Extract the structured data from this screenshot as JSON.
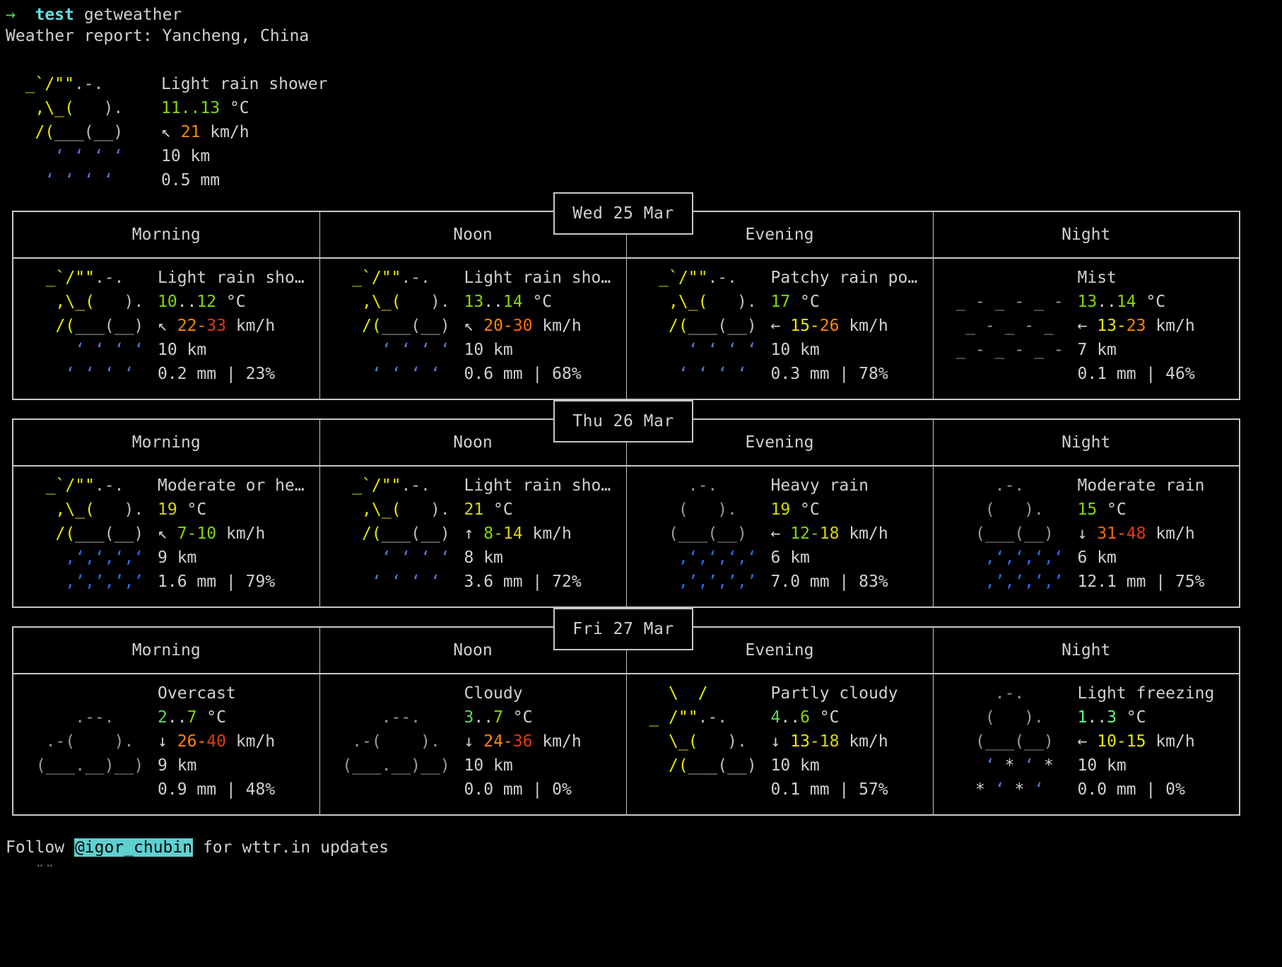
{
  "terminal": {
    "prompt_symbol": "→",
    "command_name": "test",
    "command_arg": "getweather",
    "report_header": "Weather report: Yancheng, China",
    "footer_prefix": "Follow ",
    "footer_handle": "@igor_chubin",
    "footer_suffix": " for wttr.in updates",
    "footer_cutoff": "   \"\"."
  },
  "current": {
    "art": [
      "  _`/\"\".-.  ",
      "   ,\\_(   ). ",
      "   /(___(__) ",
      "     ‘ ‘ ‘ ‘ ",
      "    ‘ ‘ ‘ ‘  "
    ],
    "condition": "Light rain shower",
    "temp": "11..13",
    "temp_unit": " °C",
    "wind_arrow": "↖",
    "wind": "21",
    "wind_unit": " km/h",
    "visibility": "10 km",
    "precip": "0.5 mm"
  },
  "period_labels": [
    "Morning",
    "Noon",
    "Evening",
    "Night"
  ],
  "days": [
    {
      "date": "Wed 25 Mar",
      "cells": [
        {
          "period": "Morning",
          "art_style": "rain-shower",
          "art": [
            "  _`/\"\".-.",
            "   ,\\_(   ).",
            "   /(___(__)",
            "     ‘ ‘ ‘ ‘",
            "    ‘ ‘ ‘ ‘"
          ],
          "condition": "Light rain sho…",
          "temp_lo": "10",
          "temp_sep": "..",
          "temp_hi": "12",
          "temp_unit": " °C",
          "temp_lo_color": "lime",
          "temp_hi_color": "lime",
          "wind_arrow": "↖",
          "wind_lo": "22",
          "wind_hi": "33",
          "wind_lo_color": "orange",
          "wind_hi_color": "red",
          "wind_unit": " km/h",
          "visibility": "10 km",
          "precip": "0.2 mm | 23%"
        },
        {
          "period": "Noon",
          "art_style": "rain-shower",
          "art": [
            "  _`/\"\".-.",
            "   ,\\_(   ).",
            "   /(___(__)",
            "     ‘ ‘ ‘ ‘",
            "    ‘ ‘ ‘ ‘"
          ],
          "condition": "Light rain sho…",
          "temp_lo": "13",
          "temp_sep": "..",
          "temp_hi": "14",
          "temp_unit": " °C",
          "temp_lo_color": "lime",
          "temp_hi_color": "lime",
          "wind_arrow": "↖",
          "wind_lo": "20",
          "wind_hi": "30",
          "wind_lo_color": "orange",
          "wind_hi_color": "darkorange",
          "wind_unit": " km/h",
          "visibility": "10 km",
          "precip": "0.6 mm | 68%"
        },
        {
          "period": "Evening",
          "art_style": "rain-shower",
          "art": [
            "  _`/\"\".-.",
            "   ,\\_(   ).",
            "   /(___(__)",
            "     ‘ ‘ ‘ ‘",
            "    ‘ ‘ ‘ ‘"
          ],
          "condition": "Patchy rain po…",
          "temp_lo": "17",
          "temp_sep": "",
          "temp_hi": "",
          "temp_unit": " °C",
          "temp_lo_color": "lime",
          "temp_hi_color": "lime",
          "wind_arrow": "←",
          "wind_lo": "15",
          "wind_hi": "26",
          "wind_lo_color": "yellow",
          "wind_hi_color": "orange",
          "wind_unit": " km/h",
          "visibility": "10 km",
          "precip": "0.3 mm | 78%"
        },
        {
          "period": "Night",
          "art_style": "mist",
          "art": [
            " _ - _ - _ -",
            "  _ - _ - _",
            " _ - _ - _ -"
          ],
          "condition": "Mist",
          "temp_lo": "13",
          "temp_sep": "..",
          "temp_hi": "14",
          "temp_unit": " °C",
          "temp_lo_color": "lime",
          "temp_hi_color": "lime",
          "wind_arrow": "←",
          "wind_lo": "13",
          "wind_hi": "23",
          "wind_lo_color": "yellow",
          "wind_hi_color": "orange",
          "wind_unit": " km/h",
          "visibility": "7 km",
          "precip": "0.1 mm | 46%"
        }
      ]
    },
    {
      "date": "Thu 26 Mar",
      "cells": [
        {
          "period": "Morning",
          "art_style": "heavy-rain-sun",
          "art": [
            "  _`/\"\".-.",
            "   ,\\_(   ).",
            "   /(___(__)",
            "    ‚‘‚‘‚‘‚‘",
            "    ‚’‚’‚’‚’"
          ],
          "condition": "Moderate or he…",
          "temp_lo": "19",
          "temp_sep": "",
          "temp_hi": "",
          "temp_unit": " °C",
          "temp_lo_color": "gold",
          "temp_hi_color": "gold",
          "wind_arrow": "↖",
          "wind_lo": "7",
          "wind_hi": "10",
          "wind_lo_color": "lime",
          "wind_hi_color": "lime",
          "wind_unit": " km/h",
          "visibility": "9 km",
          "precip": "1.6 mm | 79%"
        },
        {
          "period": "Noon",
          "art_style": "rain-shower",
          "art": [
            "  _`/\"\".-.",
            "   ,\\_(   ).",
            "   /(___(__)",
            "     ‘ ‘ ‘ ‘",
            "    ‘ ‘ ‘ ‘"
          ],
          "condition": "Light rain sho…",
          "temp_lo": "21",
          "temp_sep": "",
          "temp_hi": "",
          "temp_unit": " °C",
          "temp_lo_color": "gold",
          "temp_hi_color": "gold",
          "wind_arrow": "↑",
          "wind_lo": "8",
          "wind_hi": "14",
          "wind_lo_color": "lime",
          "wind_hi_color": "gold",
          "wind_unit": " km/h",
          "visibility": "8 km",
          "precip": "3.6 mm | 72%"
        },
        {
          "period": "Evening",
          "art_style": "heavy-rain",
          "art": [
            "     .-.",
            "    (   ).",
            "   (___(__)",
            "    ‚‘‚‘‚‘‚‘",
            "    ‚’‚’‚’‚’"
          ],
          "condition": "Heavy rain",
          "temp_lo": "19",
          "temp_sep": "",
          "temp_hi": "",
          "temp_unit": " °C",
          "temp_lo_color": "gold",
          "temp_hi_color": "gold",
          "wind_arrow": "←",
          "wind_lo": "12",
          "wind_hi": "18",
          "wind_lo_color": "lime",
          "wind_hi_color": "gold",
          "wind_unit": " km/h",
          "visibility": "6 km",
          "precip": "7.0 mm | 83%"
        },
        {
          "period": "Night",
          "art_style": "heavy-rain",
          "art": [
            "     .-.",
            "    (   ).",
            "   (___(__)",
            "    ‚‘‚‘‚‘‚‘",
            "    ‚’‚’‚’‚’"
          ],
          "condition": "Moderate rain",
          "temp_lo": "15",
          "temp_sep": "",
          "temp_hi": "",
          "temp_unit": " °C",
          "temp_lo_color": "lime",
          "temp_hi_color": "lime",
          "wind_arrow": "↓",
          "wind_lo": "31",
          "wind_hi": "48",
          "wind_lo_color": "darkorange",
          "wind_hi_color": "red",
          "wind_unit": " km/h",
          "visibility": "6 km",
          "precip": "12.1 mm | 75%"
        }
      ]
    },
    {
      "date": "Fri 27 Mar",
      "cells": [
        {
          "period": "Morning",
          "art_style": "overcast",
          "art": [
            "     .--.",
            "  .-(    ).",
            " (___.__)__)"
          ],
          "condition": "Overcast",
          "temp_lo": "2",
          "temp_sep": "..",
          "temp_hi": "7",
          "temp_unit": " °C",
          "temp_lo_color": "green",
          "temp_hi_color": "lime",
          "wind_arrow": "↓",
          "wind_lo": "26",
          "wind_hi": "40",
          "wind_lo_color": "orange",
          "wind_hi_color": "red",
          "wind_unit": " km/h",
          "visibility": "9 km",
          "precip": "0.9 mm | 48%"
        },
        {
          "period": "Noon",
          "art_style": "overcast",
          "art": [
            "     .--.",
            "  .-(    ).",
            " (___.__)__)"
          ],
          "condition": "Cloudy",
          "temp_lo": "3",
          "temp_sep": "..",
          "temp_hi": "7",
          "temp_unit": " °C",
          "temp_lo_color": "green",
          "temp_hi_color": "lime",
          "wind_arrow": "↓",
          "wind_lo": "24",
          "wind_hi": "36",
          "wind_lo_color": "orange",
          "wind_hi_color": "red",
          "wind_unit": " km/h",
          "visibility": "10 km",
          "precip": "0.0 mm | 0%"
        },
        {
          "period": "Evening",
          "art_style": "partly-cloudy",
          "art": [
            "   \\  /",
            " _ /\"\".-.",
            "   \\_(   ).",
            "   /(___(__)"
          ],
          "condition": "Partly cloudy",
          "temp_lo": "4",
          "temp_sep": "..",
          "temp_hi": "6",
          "temp_unit": " °C",
          "temp_lo_color": "green",
          "temp_hi_color": "lime",
          "wind_arrow": "↓",
          "wind_lo": "13",
          "wind_hi": "18",
          "wind_lo_color": "yellow",
          "wind_hi_color": "gold",
          "wind_unit": " km/h",
          "visibility": "10 km",
          "precip": "0.1 mm | 57%"
        },
        {
          "period": "Night",
          "art_style": "sleet",
          "art": [
            "     .-.",
            "    (   ).",
            "   (___(__)",
            "    ‘ * ‘ *",
            "   * ‘ * ‘"
          ],
          "condition": "Light freezing",
          "temp_lo": "1",
          "temp_sep": "..",
          "temp_hi": "3",
          "temp_unit": " °C",
          "temp_lo_color": "greenbright",
          "temp_hi_color": "greenbright",
          "wind_arrow": "←",
          "wind_lo": "10",
          "wind_hi": "15",
          "wind_lo_color": "yellow",
          "wind_hi_color": "yellow",
          "wind_unit": " km/h",
          "visibility": "10 km",
          "precip": "0.0 mm | 0%"
        }
      ]
    }
  ]
}
